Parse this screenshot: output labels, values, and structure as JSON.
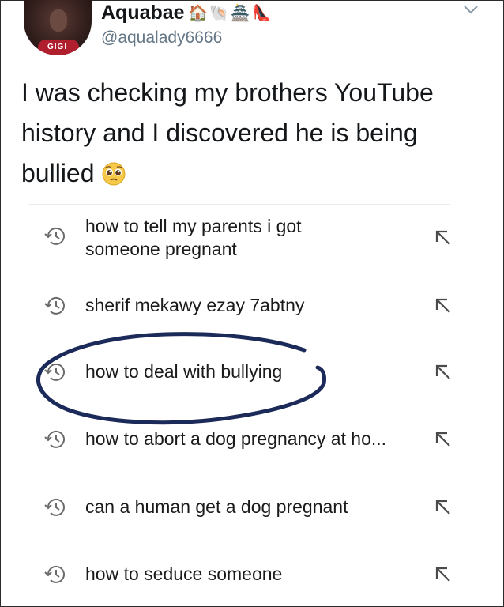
{
  "tweet": {
    "display_name": "Aquabae",
    "name_emojis": "🏠🐚🏯👠",
    "handle": "@aqualady6666",
    "text": "I was checking my brothers YouTube history and I discovered he is being bullied",
    "avatar_shirt_text": "GIGI"
  },
  "search_history": [
    {
      "line1": "how to tell my parents i got",
      "line2": "someone pregnant"
    },
    {
      "line1": "sherif mekawy ezay 7abtny"
    },
    {
      "line1": "how to deal with bullying",
      "circled": true
    },
    {
      "line1": "how to abort a dog pregnancy at ho..."
    },
    {
      "line1": "can a human get a dog pregnant"
    },
    {
      "line1": "how to seduce someone"
    }
  ],
  "colors": {
    "text": "#14171a",
    "handle": "#657786",
    "marker": "#1c2a5a"
  },
  "icons": {
    "history": "clock-history-icon",
    "fill_query": "arrow-up-left-icon",
    "menu": "chevron-down-icon",
    "emoji": "pleading-face-emoji"
  }
}
